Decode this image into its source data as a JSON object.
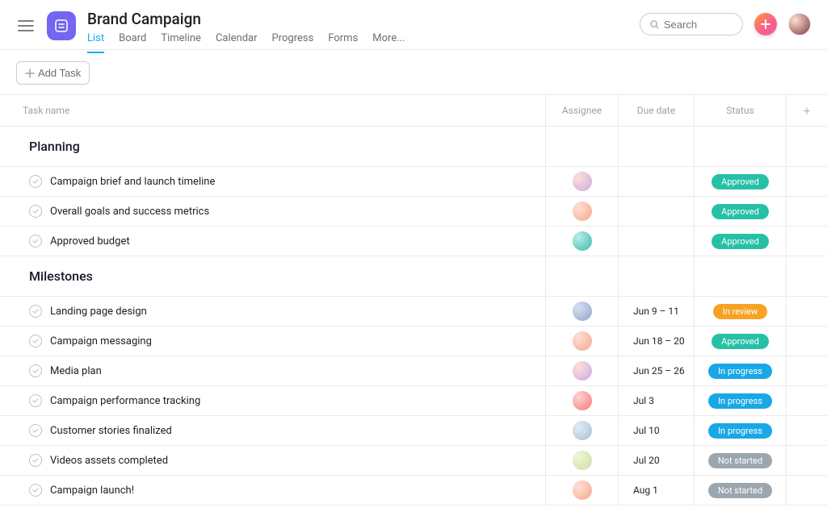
{
  "header": {
    "title": "Brand Campaign",
    "tabs": [
      "List",
      "Board",
      "Timeline",
      "Calendar",
      "Progress",
      "Forms",
      "More..."
    ],
    "active_tab": 0,
    "search_placeholder": "Search"
  },
  "toolbar": {
    "add_task_label": "Add Task"
  },
  "columns": {
    "name": "Task name",
    "assignee": "Assignee",
    "due": "Due date",
    "status": "Status"
  },
  "status_colors": {
    "Approved": "status-approved",
    "In review": "status-inreview",
    "In progress": "status-inprogress",
    "Not started": "status-notstarted"
  },
  "sections": [
    {
      "title": "Planning",
      "tasks": [
        {
          "name": "Campaign brief and launch timeline",
          "assignee": "av1",
          "due": "",
          "status": "Approved"
        },
        {
          "name": "Overall goals and success metrics",
          "assignee": "av2",
          "due": "",
          "status": "Approved"
        },
        {
          "name": "Approved budget",
          "assignee": "av3",
          "due": "",
          "status": "Approved"
        }
      ]
    },
    {
      "title": "Milestones",
      "tasks": [
        {
          "name": "Landing page design",
          "assignee": "av4",
          "due": "Jun 9 – 11",
          "status": "In review"
        },
        {
          "name": "Campaign messaging",
          "assignee": "av2",
          "due": "Jun 18 – 20",
          "status": "Approved"
        },
        {
          "name": "Media plan",
          "assignee": "av1",
          "due": "Jun 25 – 26",
          "status": "In progress"
        },
        {
          "name": "Campaign performance tracking",
          "assignee": "av5",
          "due": "Jul 3",
          "status": "In progress"
        },
        {
          "name": "Customer stories finalized",
          "assignee": "av6",
          "due": "Jul 10",
          "status": "In progress"
        },
        {
          "name": "Videos assets completed",
          "assignee": "av7",
          "due": "Jul 20",
          "status": "Not started"
        },
        {
          "name": "Campaign launch!",
          "assignee": "av2",
          "due": "Aug 1",
          "status": "Not started"
        }
      ]
    }
  ]
}
